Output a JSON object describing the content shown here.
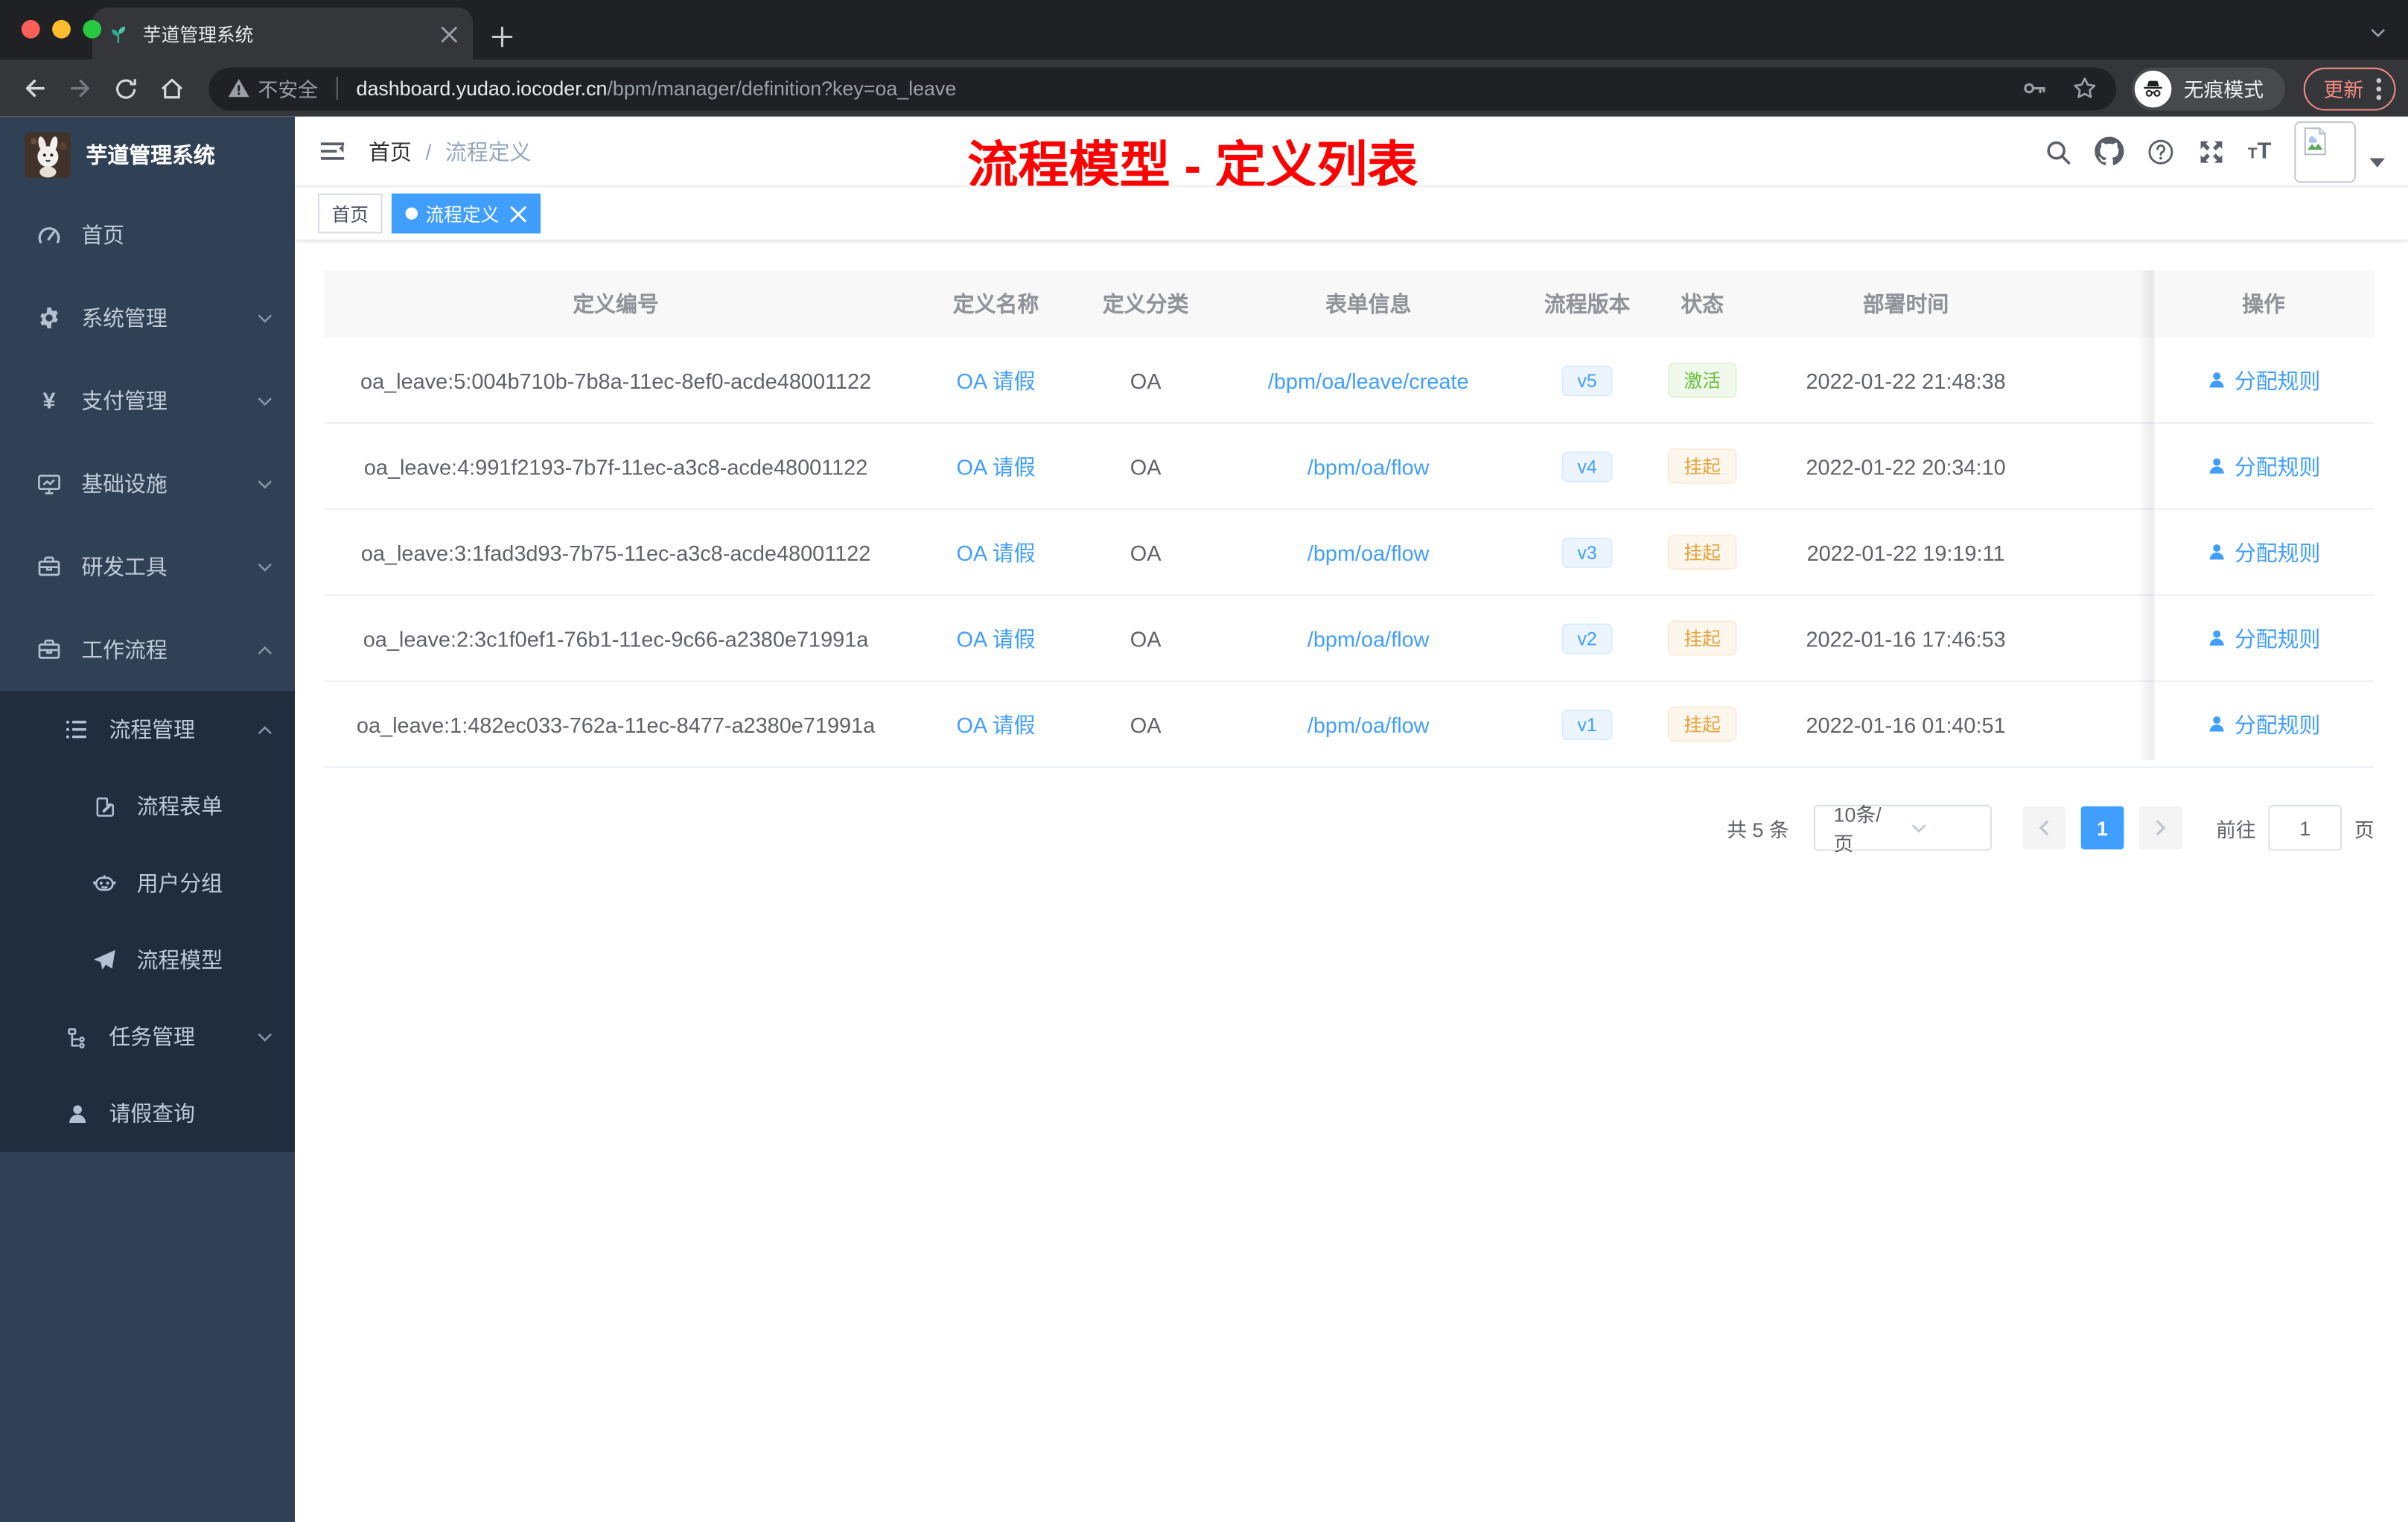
{
  "browser": {
    "tab_title": "芋道管理系统",
    "security_label": "不安全",
    "url_domain": "dashboard.yudao.iocoder.cn",
    "url_path": "/bpm/manager/definition?key=oa_leave",
    "incognito_label": "无痕模式",
    "update_label": "更新"
  },
  "sidebar": {
    "logo_title": "芋道管理系统",
    "menu": [
      {
        "id": "home",
        "label": "首页",
        "icon": "dashboard-icon"
      },
      {
        "id": "system",
        "label": "系统管理",
        "icon": "gear-icon",
        "expandable": true,
        "expanded": false
      },
      {
        "id": "payment",
        "label": "支付管理",
        "icon": "yen-icon",
        "expandable": true,
        "expanded": false
      },
      {
        "id": "infrastructure",
        "label": "基础设施",
        "icon": "monitor-icon",
        "expandable": true,
        "expanded": false
      },
      {
        "id": "dev-tools",
        "label": "研发工具",
        "icon": "toolbox-icon",
        "expandable": true,
        "expanded": false
      },
      {
        "id": "workflow",
        "label": "工作流程",
        "icon": "briefcase-icon",
        "expandable": true,
        "expanded": true,
        "children": [
          {
            "id": "process-management",
            "label": "流程管理",
            "icon": "tree-table-icon",
            "expandable": true,
            "expanded": true,
            "children": [
              {
                "id": "process-form",
                "label": "流程表单",
                "icon": "form-edit-icon"
              },
              {
                "id": "user-group",
                "label": "用户分组",
                "icon": "robot-icon"
              },
              {
                "id": "process-model",
                "label": "流程模型",
                "icon": "paper-plane-icon"
              }
            ]
          },
          {
            "id": "task-management",
            "label": "任务管理",
            "icon": "org-tree-icon",
            "expandable": true,
            "expanded": false
          },
          {
            "id": "leave-query",
            "label": "请假查询",
            "icon": "user-icon"
          }
        ]
      }
    ]
  },
  "header": {
    "breadcrumb": [
      "首页",
      "/",
      "流程定义"
    ],
    "annotation": "流程模型 - 定义列表"
  },
  "tags": [
    {
      "id": "home",
      "label": "首页",
      "active": false,
      "closable": false
    },
    {
      "id": "process-definition",
      "label": "流程定义",
      "active": true,
      "closable": true
    }
  ],
  "table": {
    "columns": [
      "定义编号",
      "定义名称",
      "定义分类",
      "表单信息",
      "流程版本",
      "状态",
      "部署时间",
      "操作"
    ],
    "rows": [
      {
        "id": "oa_leave:5:004b710b-7b8a-11ec-8ef0-acde48001122",
        "name": "OA 请假",
        "category": "OA",
        "form": "/bpm/oa/leave/create",
        "version": "v5",
        "status": "激活",
        "status_type": "success",
        "deployed": "2022-01-22 21:48:38",
        "action": "分配规则"
      },
      {
        "id": "oa_leave:4:991f2193-7b7f-11ec-a3c8-acde48001122",
        "name": "OA 请假",
        "category": "OA",
        "form": "/bpm/oa/flow",
        "version": "v4",
        "status": "挂起",
        "status_type": "warning",
        "deployed": "2022-01-22 20:34:10",
        "action": "分配规则"
      },
      {
        "id": "oa_leave:3:1fad3d93-7b75-11ec-a3c8-acde48001122",
        "name": "OA 请假",
        "category": "OA",
        "form": "/bpm/oa/flow",
        "version": "v3",
        "status": "挂起",
        "status_type": "warning",
        "deployed": "2022-01-22 19:19:11",
        "action": "分配规则"
      },
      {
        "id": "oa_leave:2:3c1f0ef1-76b1-11ec-9c66-a2380e71991a",
        "name": "OA 请假",
        "category": "OA",
        "form": "/bpm/oa/flow",
        "version": "v2",
        "status": "挂起",
        "status_type": "warning",
        "deployed": "2022-01-16 17:46:53",
        "action": "分配规则"
      },
      {
        "id": "oa_leave:1:482ec033-762a-11ec-8477-a2380e71991a",
        "name": "OA 请假",
        "category": "OA",
        "form": "/bpm/oa/flow",
        "version": "v1",
        "status": "挂起",
        "status_type": "warning",
        "deployed": "2022-01-16 01:40:51",
        "action": "分配规则"
      }
    ]
  },
  "pagination": {
    "total_label": "共 5 条",
    "page_size": "10条/页",
    "current_page": "1",
    "goto_label": "前往",
    "goto_value": "1",
    "page_unit": "页"
  },
  "colors": {
    "accent_blue": "#409eff",
    "status_active_green": "#67c23a",
    "status_suspended_orange": "#e6a23c",
    "sidebar_bg": "#304156",
    "submenu_bg": "#1f2d3d",
    "annotation_red": "#fe0000",
    "update_button_red": "#f28b82"
  }
}
